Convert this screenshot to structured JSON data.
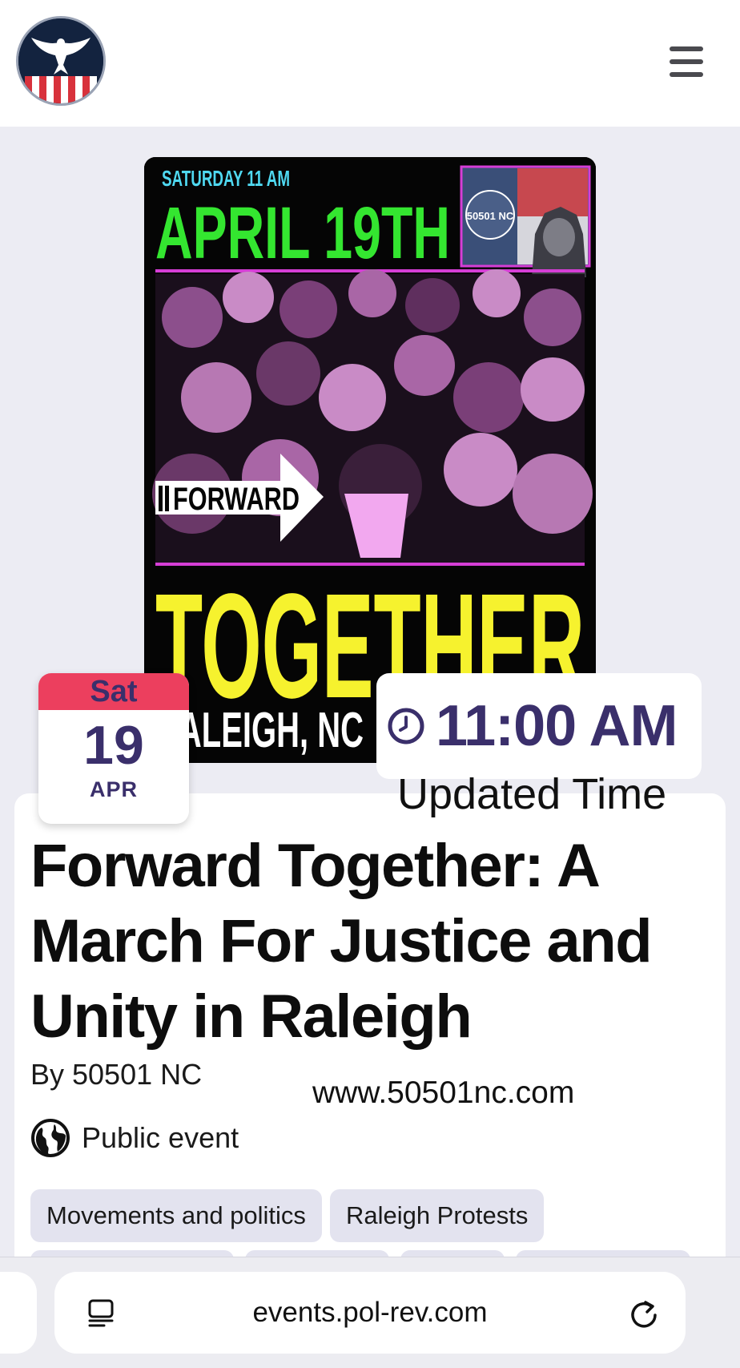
{
  "header": {
    "logo_icon": "eagle-flag-logo",
    "menu_icon": "hamburger-menu-icon"
  },
  "poster": {
    "top_line": "SATURDAY 11 AM",
    "date": "APRIL 19TH",
    "badge_text": "50501 NC",
    "forward": "FORWARD",
    "together": "TOGETHER",
    "city": "RALEIGH, NC"
  },
  "date_badge": {
    "day_of_week": "Sat",
    "day": "19",
    "month": "APR"
  },
  "time_badge": {
    "time": "11:00 AM",
    "note": "Updated Time"
  },
  "event": {
    "title": "Forward Together: A March For Justice and Unity in Raleigh",
    "by": "By 50501 NC",
    "website": "www.50501nc.com",
    "visibility": "Public event",
    "tags": [
      "Movements and politics",
      "Raleigh Protests"
    ]
  },
  "browser": {
    "url": "events.pol-rev.com"
  },
  "colors": {
    "accent_purple": "#3a2f6b",
    "badge_red": "#ec3f5e",
    "poster_green": "#34e630",
    "poster_yellow": "#f6f22e",
    "poster_cyan": "#4fd8f0",
    "poster_magenta": "#d63ed6"
  }
}
